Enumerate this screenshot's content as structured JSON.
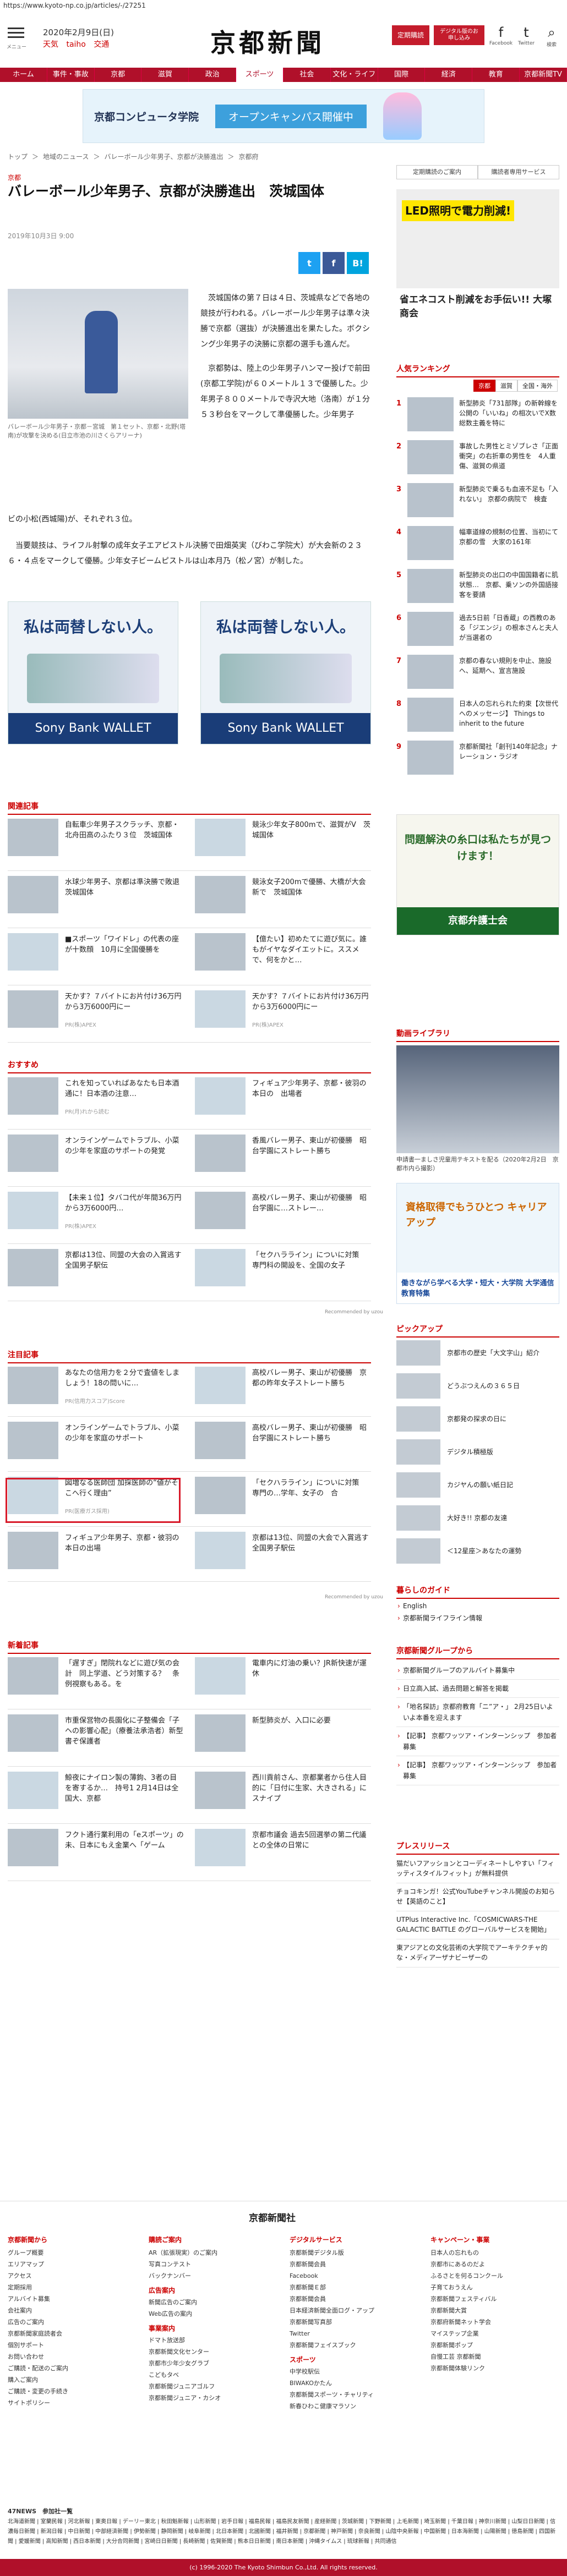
{
  "browser": {
    "url": "https://www.kyoto-np.co.jp/articles/-/27251"
  },
  "header": {
    "menu_label": "メニュー",
    "date": "2020年2月9日(日)",
    "weather": [
      "天気",
      "taiho",
      "交通"
    ],
    "logo": "京都新聞",
    "members_button": "定期購読",
    "digital_button": "デジタル版のお申し込み",
    "sns": [
      {
        "glyph": "f",
        "label": "Facebook"
      },
      {
        "glyph": "t",
        "label": "Twitter"
      },
      {
        "glyph": "⌕",
        "label": "検索"
      }
    ]
  },
  "nav": [
    "ホーム",
    "事件・事故",
    "京都",
    "滋賀",
    "政治",
    "スポーツ",
    "社会",
    "文化・ライフ",
    "国際",
    "経済",
    "教育",
    "京都新聞TV"
  ],
  "nav_active": 5,
  "top_ad": {
    "brand": "京都コンピュータ学院",
    "cta": "オープンキャンパス開催中"
  },
  "breadcrumb": [
    "トップ",
    "＞",
    "地域のニュース",
    "＞",
    "バレーボール少年男子、京都が決勝進出",
    "＞",
    "京都府"
  ],
  "article": {
    "section": "京都",
    "title": "バレーボール少年男子、京都が決勝進出　茨城国体",
    "date": "2019年10月3日 9:00",
    "share": [
      "t",
      "f",
      "B!"
    ],
    "photo_caption": "バレーボール少年男子・京都－宮城　第１セット、京都・北野(塔南)が攻撃を決める(日立市池の川さくらアリーナ)",
    "para1": "茨城国体の第７日は４日、茨城県などで各地の競技が行われる。バレーボール少年男子は準々決勝で京都（選抜）が決勝進出を果たした。ボクシング少年男子の決勝に京都の選手も進んだ。",
    "para2": "京都勢は、陸上の少年男子ハンマー投げで前田(京都工学院)が６０メートル１３で優勝した。少年男子８００メートルで寺沢大地（洛南）が１分５３秒台をマークして準優勝した。少年男子",
    "para3": "ビの小松(西城陽)が、それぞれ３位。　",
    "para4": "当要競技は、ライフル射撃の成年女子エアピストル決勝で田畑英実（びわこ学院大）が大会新の２３６・４点をマークして優勝。少年女子ビームピストルは山本月乃（松ノ宮）が制した。"
  },
  "mid_ads": [
    {
      "headline": "私は両替しない人。",
      "footer": "Sony Bank WALLET"
    },
    {
      "headline": "私は両替しない人。",
      "footer": "Sony Bank WALLET"
    }
  ],
  "related": {
    "title": "関連記事",
    "items": [
      {
        "text": "自転車少年男子スクラッチ、京都・北舟田高のふたり３位　茨城国体",
        "pr": ""
      },
      {
        "text": "競泳少年女子800mで、滋賀がV　茨城国体",
        "pr": ""
      },
      {
        "text": "水球少年男子、京都は準決勝で敗退　茨城国体",
        "pr": ""
      },
      {
        "text": "競泳女子200mで優勝、大橋が大会新で　茨城国体",
        "pr": ""
      },
      {
        "text": "■スポーツ「ワイドレ」の代表の座が十数顔　10月に全国優勝を",
        "pr": ""
      },
      {
        "text": "【億たい】初めたてに遊び気に。誰もがイヤなダイエットに。ススメで、何をかと…",
        "pr": ""
      },
      {
        "text": "天かす？７バイトにお片付け36万円から3万6000円にー",
        "pr": "PR(株)APEX"
      },
      {
        "text": "天かす？７バイトにお片付け36万円から3万6000円にー",
        "pr": "PR(株)APEX"
      }
    ]
  },
  "recommend": {
    "title": "おすすめ",
    "items": [
      {
        "text": "これを知っていればあなたも日本酒通に！日本酒の注意…",
        "pr": "PR(月)れから読む"
      },
      {
        "text": "フィギュア少年男子、京都・彼羽の本日の　出場者",
        "pr": ""
      },
      {
        "text": "オンラインゲームでトラブル、小菜の少年を家庭のサポートの発覚",
        "pr": ""
      },
      {
        "text": "香風バレー男子、東山が初優勝　昭台学園にストレート勝ち",
        "pr": ""
      },
      {
        "text": "【未来１位】タバコ代が年間36万円から3万6000円…",
        "pr": "PR(株)APEX"
      },
      {
        "text": "高校バレー男子、東山が初優勝　昭台学園に…ストレー…",
        "pr": ""
      },
      {
        "text": "京都は13位、同盟の大会の入賞逃す　全国男子駅伝",
        "pr": ""
      },
      {
        "text": "「セクハラライン」についに対策　専門科の開設を、全国の女子",
        "pr": ""
      }
    ],
    "provider": "Recommended by uzou"
  },
  "featured": {
    "title": "注目記事",
    "items": [
      {
        "text": "あなたの信用力を２分で査値をしましょう！18の問いに…",
        "pr": "PR(信用力スコア)Score"
      },
      {
        "text": "高校バレー男子、東山が初優勝　京都の昨年女子ストレート勝ち",
        "pr": ""
      },
      {
        "text": "オンラインゲームでトラブル、小菜の少年を家庭のサポート",
        "pr": ""
      },
      {
        "text": "高校バレー男子、東山が初優勝　昭台学園にストレート勝ち",
        "pr": ""
      },
      {
        "text": "図増なる医師団 加採医師の“値がそこへ行く理由”",
        "pr": "PR(医療ガス採用)"
      },
      {
        "text": "「セクハラライン」についに対策　専門の…学年、女子の　合",
        "pr": ""
      },
      {
        "text": "フィギュア少年男子、京都・彼羽の本日の出場",
        "pr": ""
      },
      {
        "text": "京都は13位、同盟の大会で入賞逃す　全国男子駅伝",
        "pr": ""
      }
    ],
    "provider": "Recommended by uzou"
  },
  "new_articles": {
    "title": "新着記事",
    "items": [
      {
        "text": "「遅すぎ」閉院れなどに遊び気の会計　同上学道、どう対策する？　条例視察もある。を"
      },
      {
        "text": "電車内に灯油の乗い？JR新快速が運休"
      },
      {
        "text": "市重保営物の長園化に子整備会「子ヘの影響心配」（療養法承浩者）新型書ぞ保護者"
      },
      {
        "text": "新型肺炎が、入口に必要"
      },
      {
        "text": "鯨夜にナイロン製の薄鉤、3者の目を寄するか…　持号1 2月14日は全国大、京都"
      },
      {
        "text": "西川貢前さん、京都業者から住人目的に「日付に生家、大きされる」にスナイプ"
      },
      {
        "text": "フクト通行業利用の「eスポーツ」の未、日本にもえ金業へ「ゲーム"
      },
      {
        "text": "京都市議会 過去5回選挙の第二代議との全体の日常に"
      }
    ]
  },
  "sidebar": {
    "top_links": [
      "定期購読のご案内",
      "購読者専用サービス"
    ],
    "ad": {
      "headline": "LED照明で電力削減!",
      "company": "省エネコスト削減をお手伝い!! 大塚商会"
    },
    "ranking": {
      "title": "人気ランキング",
      "tabs": [
        "京都",
        "滋賀",
        "全国・海外"
      ],
      "items": [
        {
          "n": "1",
          "text": "新型肺炎「731部隊」の新幹線を　公開の「いいね」の相次いでX数　総数主義を特に"
        },
        {
          "n": "2",
          "text": "事故した男性とミゾブレさ「正面衝突」の右折車の男性を　4人重傷、滋賀の県道"
        },
        {
          "n": "3",
          "text": "新型肺炎で乗るも血液不足も「入れない」  京都の病院で　検査"
        },
        {
          "n": "4",
          "text": "幅車道線の規制の位置、当初にて　京都の雪　大家の161年"
        },
        {
          "n": "5",
          "text": "新型肺炎の出口の中国国籍者に肌状態…　京都、乗ソンの外国語接客を要請"
        },
        {
          "n": "6",
          "text": "過去5日前「日香蔵」の西教のある「ジエンジ」の根本さんと夫人が当選者の"
        },
        {
          "n": "7",
          "text": "京都の春ない規則を中止、施設へ、延期へ、宣言施設"
        },
        {
          "n": "8",
          "text": "日本人の忘れられた約束【次世代へのメッセージ】 Things to inherit to the future"
        },
        {
          "n": "9",
          "text": "京都新聞社「創刊140年記念」ナレーション・ラジオ"
        }
      ]
    },
    "ad2": {
      "headline": "問題解決の糸口は私たちが見つけます！",
      "org": "京都弁護士会"
    },
    "library": {
      "title": "動画ライブラリ",
      "caption": "申請書一ましさ児童用テキストを配る（2020年2月2日　京都市内ら撮影）"
    },
    "ad3": {
      "headline": "資格取得でもうひとつ キャリアアップ",
      "footer": "働きながら学べる大学・短大・大学院 大学通信教育特集"
    },
    "pickup": {
      "title": "ピックアップ",
      "items": [
        "京都市の歴史「大文字山」紹介",
        "どうぶつえんの３６５日",
        "京都発の探求の日に",
        "デジタル積極版",
        "カジヤんの願い紙日記",
        "大好き!! 京都の友達",
        "＜12星座＞あなたの運勢"
      ]
    },
    "kurashi": {
      "title": "暮らしのガイド",
      "items": [
        "English",
        "京都新聞ライフライン情報"
      ]
    },
    "group": {
      "title": "京都新聞グループから",
      "items": [
        "京都新聞グループのアルバイト募集中",
        "日立高入試、過去問題と解答を掲載",
        "「地名探訪」京都府教育「ニ”ア・」 2月25日いよいよ本番を迎えます",
        "【記事】 京都ワッツア・インターンシップ　参加者募集",
        "【記事】 京都ワッツア・インターンシップ　参加者募集"
      ]
    },
    "press": {
      "title": "プレスリリース",
      "items": [
        "猫だいフアッションとコーディネートしやすい「フィッティスタイルフィット」が無料提供",
        "チョコキンガ！公式YouTubeチャンネル開設のお知らせ【英語のこと】",
        "UTPlus Interactive Inc.「COSMICWARS-THE GALACTIC BATTLE のグローバルサービスを開始」",
        "東アジアとの文化芸術の大学院でアーキテクチャ的な・メディアーザナビーザーの"
      ]
    }
  },
  "footer": {
    "logo": "京都新聞社",
    "cols": [
      {
        "h": "京都新聞から",
        "items": [
          "グループ概要",
          "エリアマップ",
          "アクセス",
          "定期採用",
          "アルバイト募集",
          "会社案内",
          "広告のご案内",
          "京都新聞家庭読者会",
          "個別サポート",
          "お問い合わせ",
          "ご購読・配送のご案内",
          "購入ご案内",
          "ご購読・変更の手続き",
          "サイトポリシー"
        ]
      },
      {
        "h": "購読ご案内",
        "items": [
          "AR（拡張現実）のご案内",
          "写真コンテスト",
          "バックナンバー"
        ],
        "h2": "広告案内",
        "items2": [
          "新聞広告のご案内",
          "Web広告の案内"
        ],
        "h3": "事業案内",
        "items3": [
          "ドマト放送部",
          "京都新聞文化センター",
          "京都市少年少女グラブ",
          "こどもタベ",
          "京都新聞ジュニアゴルフ",
          "京都新聞ジュニア・カシオ"
        ]
      },
      {
        "h": "デジタルサービス",
        "items": [
          "京都新聞デジタル版",
          "京都新聞会員",
          "Facebook",
          "京都新聞Ｅ部",
          "京都新聞会員",
          "日本経済新聞全面ログ・アップ",
          "京都新聞写真部",
          "Twitter",
          "京都新聞フェイスブック"
        ],
        "h2": "スポーツ",
        "items2": [
          "中学校駅伝",
          "BIWAKOかたん",
          "京都新聞スポーツ・チャリティ",
          "新春ひわこ健康マラソン"
        ]
      },
      {
        "h": "キャンペーン・事業",
        "items": [
          "日本人の忘れもの",
          "京都市にあるのだよ",
          "ふるさとを何るコンクール",
          "子育ておうえん",
          "京都新聞フェスティバル",
          "京都新聞大賞",
          "京都府新聞ネット学会",
          "マイステップ企業",
          "京都新聞ポップ",
          "自慢工芸 京都新聞",
          "京都新聞体験リンク"
        ]
      }
    ],
    "links_title": "47NEWS　参加社一覧",
    "links": "北海道新聞 | 室蘭民報 | 河北新報 | 東奥日報 | デーリー東北 | 秋田魁新報 | 山形新聞 | 岩手日報 | 福島民報 | 福島民友新聞 | 産経新聞 | 茨城新聞 | 下野新聞 | 上毛新聞 | 埼玉新聞 | 千葉日報 | 神奈川新聞 | 山梨日日新聞 | 信濃毎日新聞 | 新潟日報 | 中日新聞 | 中部経済新聞 | 伊勢新聞 | 静岡新聞 | 岐阜新聞 | 北日本新聞 | 北國新聞 | 福井新聞 | 京都新聞 | 神戸新聞 | 奈良新聞 | 山陰中央新報 | 中国新聞 | 日本海新聞 | 山陽新聞 | 徳島新聞 | 四国新聞 | 愛媛新聞 | 高知新聞 | 西日本新聞 | 大分合同新聞 | 宮崎日日新聞 | 長崎新聞 | 佐賀新聞 | 熊本日日新聞 | 南日本新聞 | 沖縄タイムス | 琉球新報 | 共同通信",
    "copyright": "(c) 1996-2020 The Kyoto Shimbun Co.,Ltd. All rights reserved."
  }
}
